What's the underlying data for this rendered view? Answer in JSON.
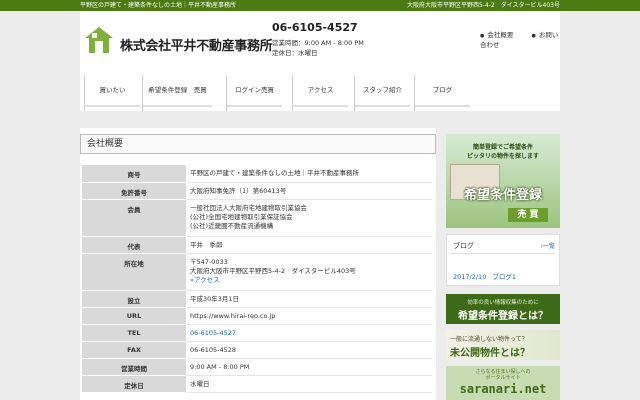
{
  "topbar": {
    "left": "平野区の戸建て・建築条件なしの土地｜平井不動産事務所",
    "right": "大阪府大阪市平野区平野西5-4-2　ダイスタービル403号"
  },
  "header": {
    "company": "株式会社平井不動産事務所",
    "phone": "06-6105-4527",
    "hours": "営業時間：9:00 AM - 8:00 PM",
    "closed": "定休日：水曜日",
    "links": [
      "会社概要",
      "お問い合わせ"
    ]
  },
  "nav": [
    "買いたい",
    "希望条件登録　売買",
    "ログイン売買",
    "アクセス",
    "スタッフ紹介",
    "ブログ"
  ],
  "main": {
    "title": "会社概要",
    "rows": [
      {
        "k": "商号",
        "v": [
          "平野区の戸建て・建築条件なしの土地｜平井不動産事務所"
        ]
      },
      {
        "k": "免許番号",
        "v": [
          "大阪府知事免許（1）第60413号"
        ]
      },
      {
        "k": "会員",
        "v": [
          "一般社団法人大阪府宅地建物取引業協会",
          "(公社)全国宅地建物取引業保証協会",
          "(公社)近畿圏不動産流通機構"
        ]
      },
      {
        "k": "代表",
        "v": [
          "平井　季郎"
        ]
      },
      {
        "k": "所在地",
        "v": [
          "〒547-0033",
          "大阪府大阪市平野区平野西5-4-2　ダイスタービル403号"
        ],
        "link": "»アクセス"
      },
      {
        "k": "設立",
        "v": [
          "平成30年3月1日"
        ]
      },
      {
        "k": "URL",
        "v": [
          "https://www.hirai-reo.co.jp"
        ]
      },
      {
        "k": "TEL",
        "v": [
          "06-6105-4527"
        ],
        "islink": true
      },
      {
        "k": "FAX",
        "v": [
          "06-6105-4528"
        ]
      },
      {
        "k": "営業時間",
        "v": [
          "9:00 AM - 8:00 PM"
        ]
      },
      {
        "k": "定休日",
        "v": [
          "水曜日"
        ]
      }
    ]
  },
  "side": {
    "banner1": {
      "line1": "簡単登録でご希望条件",
      "line2": "ピッタリの物件を探します",
      "big": "希望条件登録",
      "tag": "売 買"
    },
    "blog": {
      "title": "ブログ",
      "all": "一覧",
      "date": "2017/2/10",
      "entry": "ブログ1"
    },
    "banner2": {
      "sub": "効率の良い情報収集のために",
      "main": "希望条件登録とは？"
    },
    "banner3": {
      "sub": "一般に流通しない物件って？",
      "main": "未公開物件とは？"
    },
    "banner4": {
      "sub1": "さらなる住まい探しへの",
      "sub2": "ポータルサイト",
      "main": "saranari.net"
    }
  }
}
